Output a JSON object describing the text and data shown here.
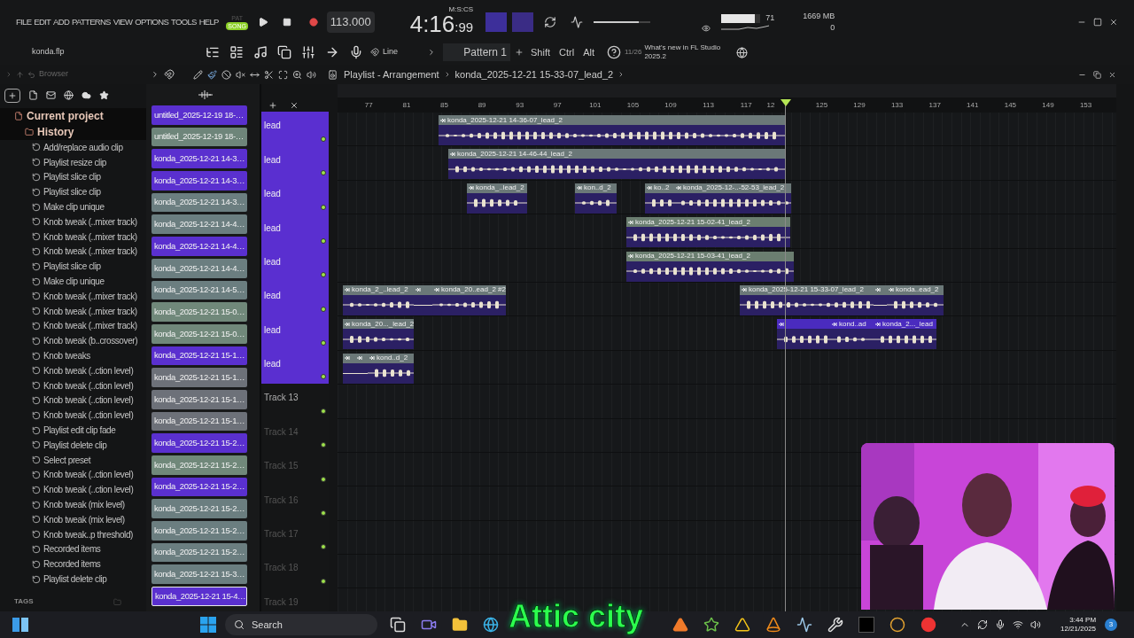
{
  "menu": [
    "FILE",
    "EDIT",
    "ADD",
    "PATTERNS",
    "VIEW",
    "OPTIONS",
    "TOOLS",
    "HELP"
  ],
  "transport": {
    "modes": [
      {
        "label": "PAT",
        "selected": false
      },
      {
        "label": "SONG",
        "selected": true
      }
    ],
    "tempo": "113.000",
    "time_main": "4:16",
    "time_fraction": ":99",
    "time_unit": "M:S:CS",
    "cpu": "71",
    "cpu_meter": {
      "level": 0.85
    },
    "master_volume": {
      "level": 0.8
    },
    "memory": "1669 MB",
    "polyphony": "0"
  },
  "project_file": "konda.flp",
  "snap": "Line",
  "pattern": "Pattern 1",
  "modifiers": [
    "Shift",
    "Ctrl",
    "Alt"
  ],
  "news": {
    "count": "11/26",
    "text": "What's new in FL Studio 2025.2"
  },
  "browser": {
    "title": "Browser",
    "project": "Current project",
    "history_label": "History",
    "history": [
      "Add/replace audio clip",
      "Playlist resize clip",
      "Playlist slice clip",
      "Playlist slice clip",
      "Make clip unique",
      "Knob tweak (..mixer track)",
      "Knob tweak (..mixer track)",
      "Knob tweak (..mixer track)",
      "Playlist slice clip",
      "Make clip unique",
      "Knob tweak (..mixer track)",
      "Knob tweak (..mixer track)",
      "Knob tweak (..mixer track)",
      "Knob tweak (b..crossover)",
      "Knob tweaks",
      "Knob tweak (..ction level)",
      "Knob tweak (..ction level)",
      "Knob tweak (..ction level)",
      "Knob tweak (..ction level)",
      "Playlist edit clip fade",
      "Playlist delete clip",
      "Select preset",
      "Knob tweak (..ction level)",
      "Knob tweak (..ction level)",
      "Knob tweak (mix level)",
      "Knob tweak (mix level)",
      "Knob tweak..p threshold)",
      "Recorded items",
      "Recorded items",
      "Playlist delete clip"
    ],
    "tags_label": "TAGS"
  },
  "playlist": {
    "title": "Playlist - Arrangement",
    "clip_name": "konda_2025-12-21 15-33-07_lead_2",
    "clip_list": [
      {
        "label": "untitled_2025-12-19 18-…",
        "color": "#5a30cf",
        "selected": false
      },
      {
        "label": "untitled_2025-12-19 18-…",
        "color": "#6e857a",
        "selected": false
      },
      {
        "label": "konda_2025-12-21 14-3…",
        "color": "#5a30cf",
        "selected": false
      },
      {
        "label": "konda_2025-12-21 14-3…",
        "color": "#5a30cf",
        "selected": false
      },
      {
        "label": "konda_2025-12-21 14-3…",
        "color": "#6b7e80",
        "selected": false
      },
      {
        "label": "konda_2025-12-21 14-4…",
        "color": "#6b7e80",
        "selected": false
      },
      {
        "label": "konda_2025-12-21 14-4…",
        "color": "#5a30cf",
        "selected": false
      },
      {
        "label": "konda_2025-12-21 14-4…",
        "color": "#6b7e80",
        "selected": false
      },
      {
        "label": "konda_2025-12-21 14-5…",
        "color": "#6b7e80",
        "selected": false
      },
      {
        "label": "konda_2025-12-21 15-0…",
        "color": "#70887a",
        "selected": false
      },
      {
        "label": "konda_2025-12-21 15-0…",
        "color": "#70887a",
        "selected": false
      },
      {
        "label": "konda_2025-12-21 15-1…",
        "color": "#5a30cf",
        "selected": false
      },
      {
        "label": "konda_2025-12-21 15-1…",
        "color": "#6d7179",
        "selected": false
      },
      {
        "label": "konda_2025-12-21 15-1…",
        "color": "#6d7179",
        "selected": false
      },
      {
        "label": "konda_2025-12-21 15-1…",
        "color": "#6d7179",
        "selected": false
      },
      {
        "label": "konda_2025-12-21 15-2…",
        "color": "#5a30cf",
        "selected": false
      },
      {
        "label": "konda_2025-12-21 15-2…",
        "color": "#70887a",
        "selected": false
      },
      {
        "label": "konda_2025-12-21 15-2…",
        "color": "#5a30cf",
        "selected": false
      },
      {
        "label": "konda_2025-12-21 15-2…",
        "color": "#6b7e80",
        "selected": false
      },
      {
        "label": "konda_2025-12-21 15-2…",
        "color": "#6b7e80",
        "selected": false
      },
      {
        "label": "konda_2025-12-21 15-2…",
        "color": "#6b7e80",
        "selected": false
      },
      {
        "label": "konda_2025-12-21 15-3…",
        "color": "#6b7e80",
        "selected": false
      },
      {
        "label": "konda_2025-12-21 15-4…",
        "color": "#5a30cf",
        "selected": true
      }
    ],
    "ruler": [
      "77",
      "81",
      "85",
      "89",
      "93",
      "97",
      "101",
      "105",
      "109",
      "113",
      "117",
      "12",
      "125",
      "129",
      "133",
      "137",
      "141",
      "145",
      "149",
      "153"
    ],
    "tracks": [
      {
        "name": "lead",
        "color": "#5a2fd0",
        "enabled": true,
        "clips": [
          {
            "label": "konda_2025-12-21 14-36-07_lead_2",
            "color": "#6b7878"
          }
        ]
      },
      {
        "name": "lead",
        "color": "#5a2fd0",
        "enabled": true,
        "clips": [
          {
            "label": "konda_2025-12-21 14-46-44_lead_2",
            "color": "#6b7878"
          }
        ]
      },
      {
        "name": "lead",
        "color": "#5a2fd0",
        "enabled": true,
        "clips": [
          {
            "label": "konda_..lead_2",
            "color": "#6b7878"
          },
          {
            "label": "kon..d_2",
            "color": "#6b7878"
          },
          {
            "label": "ko..2",
            "color": "#6b7878"
          },
          {
            "label": "konda_2025-12-..-52-53_lead_2",
            "color": "#6b7878"
          }
        ]
      },
      {
        "name": "lead",
        "color": "#5a2fd0",
        "enabled": true,
        "clips": [
          {
            "label": "konda_2025-12-21 15-02-41_lead_2",
            "color": "#6b7e70"
          }
        ]
      },
      {
        "name": "lead",
        "color": "#5a2fd0",
        "enabled": true,
        "clips": [
          {
            "label": "konda_2025-12-21 15-03-41_lead_2",
            "color": "#6b7e70"
          }
        ]
      },
      {
        "name": "lead",
        "color": "#5a2fd0",
        "enabled": true,
        "clips": [
          {
            "label": "konda_2_..lead_2",
            "color": "#6b7878"
          },
          {
            "color": "#6b7878"
          },
          {
            "label": "konda_20..ead_2 #2",
            "color": "#6b7878"
          },
          {
            "label": "konda_2025-12-21 15-33-07_lead_2",
            "color": "#6b7878"
          },
          {
            "color": "#6b7878"
          },
          {
            "label": "konda..ead_2",
            "color": "#6b7878"
          }
        ]
      },
      {
        "name": "lead",
        "color": "#5a2fd0",
        "enabled": true,
        "clips": [
          {
            "label": "konda_20..._lead_2",
            "color": "#6b7878"
          },
          {
            "color": "#4a2bbf"
          },
          {
            "label": "kond..ad",
            "color": "#4a2bbf"
          },
          {
            "label": "konda_2..._lead",
            "color": "#4a2bbf"
          }
        ]
      },
      {
        "name": "lead",
        "color": "#5a2fd0",
        "enabled": true,
        "clips": [
          {
            "color": "#6b7878"
          },
          {
            "color": "#6b7878"
          },
          {
            "label": "kond..d_2",
            "color": "#6b7878"
          }
        ]
      },
      {
        "name": "Track 13",
        "enabled": true
      },
      {
        "name": "Track 14",
        "enabled": true
      },
      {
        "name": "Track 15",
        "enabled": true
      },
      {
        "name": "Track 16",
        "enabled": true
      },
      {
        "name": "Track 17",
        "enabled": true
      },
      {
        "name": "Track 18",
        "enabled": true
      },
      {
        "name": "Track 19"
      }
    ]
  },
  "webcam": {
    "kind": "picture"
  },
  "caption": "Attic city",
  "taskbar": {
    "search": "Search",
    "time": "3:44 PM",
    "date": "12/21/2025",
    "badge": "3"
  }
}
